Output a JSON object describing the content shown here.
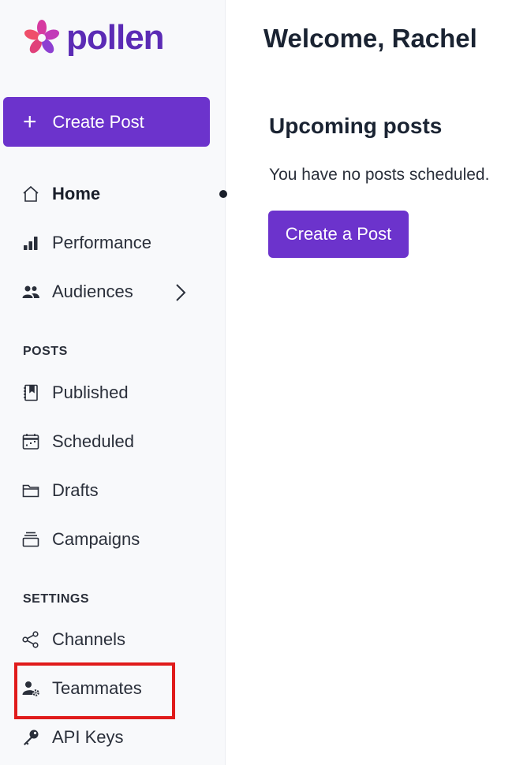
{
  "brand": {
    "name": "pollen",
    "primary_color": "#6c33cc",
    "logo_color": "#5b2bb5"
  },
  "sidebar": {
    "create_button": {
      "label": "Create Post",
      "icon": "plus-icon"
    },
    "nav": [
      {
        "label": "Home",
        "icon": "home-icon",
        "active": true
      },
      {
        "label": "Performance",
        "icon": "bar-chart-icon"
      },
      {
        "label": "Audiences",
        "icon": "users-icon",
        "has_submenu": true
      }
    ],
    "posts_section": {
      "label": "POSTS",
      "items": [
        {
          "label": "Published",
          "icon": "book-icon"
        },
        {
          "label": "Scheduled",
          "icon": "calendar-icon"
        },
        {
          "label": "Drafts",
          "icon": "folder-icon"
        },
        {
          "label": "Campaigns",
          "icon": "stack-icon"
        }
      ]
    },
    "settings_section": {
      "label": "SETTINGS",
      "items": [
        {
          "label": "Channels",
          "icon": "share-icon"
        },
        {
          "label": "Teammates",
          "icon": "user-gear-icon",
          "highlighted": true
        },
        {
          "label": "API Keys",
          "icon": "key-icon"
        }
      ]
    }
  },
  "main": {
    "welcome": "Welcome, Rachel",
    "upcoming": {
      "title": "Upcoming posts",
      "empty_message": "You have no posts scheduled.",
      "button_label": "Create a Post"
    }
  },
  "highlight_color": "#e01b1b"
}
